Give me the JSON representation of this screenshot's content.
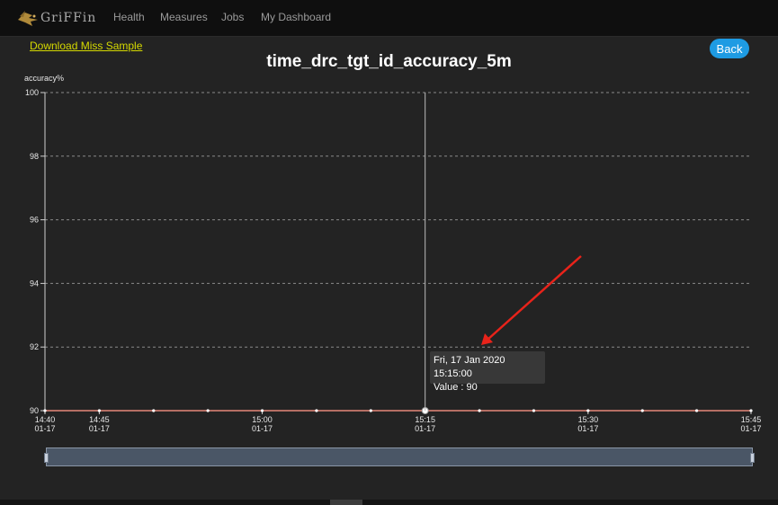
{
  "header": {
    "logo_text": "GriFFin",
    "nav": [
      "Health",
      "Measures",
      "Jobs",
      "My Dashboard"
    ]
  },
  "toolbar": {
    "download_label": "Download Miss Sample",
    "back_label": "Back"
  },
  "tooltip": {
    "date": "Fri, 17 Jan 2020 15:15:00",
    "value": "Value : 90"
  },
  "colors": {
    "series": "#e6877a",
    "accent": "#1e9be3",
    "link": "#d5d900",
    "arrow": "#e8231a"
  },
  "chart_data": {
    "type": "line",
    "title": "time_drc_tgt_id_accuracy_5m",
    "xlabel": "",
    "ylabel": "accuracy%",
    "ylim": [
      90,
      100
    ],
    "yticks": [
      90,
      92,
      94,
      96,
      98,
      100
    ],
    "xlim": [
      "2020-01-17 14:40",
      "2020-01-17 15:45"
    ],
    "xticks": [
      {
        "time": "2020-01-17 14:40",
        "label": "14:40",
        "sublabel": "01-17"
      },
      {
        "time": "2020-01-17 14:45",
        "label": "14:45",
        "sublabel": "01-17"
      },
      {
        "time": "2020-01-17 15:00",
        "label": "15:00",
        "sublabel": "01-17"
      },
      {
        "time": "2020-01-17 15:15",
        "label": "15:15",
        "sublabel": "01-17"
      },
      {
        "time": "2020-01-17 15:30",
        "label": "15:30",
        "sublabel": "01-17"
      },
      {
        "time": "2020-01-17 15:45",
        "label": "15:45",
        "sublabel": "01-17"
      }
    ],
    "grid": true,
    "highlight_x": "2020-01-17 15:15",
    "series": [
      {
        "x": [
          "2020-01-17 14:40",
          "2020-01-17 14:45",
          "2020-01-17 14:50",
          "2020-01-17 14:55",
          "2020-01-17 15:00",
          "2020-01-17 15:05",
          "2020-01-17 15:10",
          "2020-01-17 15:15",
          "2020-01-17 15:20",
          "2020-01-17 15:25",
          "2020-01-17 15:30",
          "2020-01-17 15:35",
          "2020-01-17 15:40",
          "2020-01-17 15:45"
        ],
        "values": [
          90,
          90,
          90,
          90,
          90,
          90,
          90,
          90,
          90,
          90,
          90,
          90,
          90,
          90
        ]
      }
    ]
  }
}
